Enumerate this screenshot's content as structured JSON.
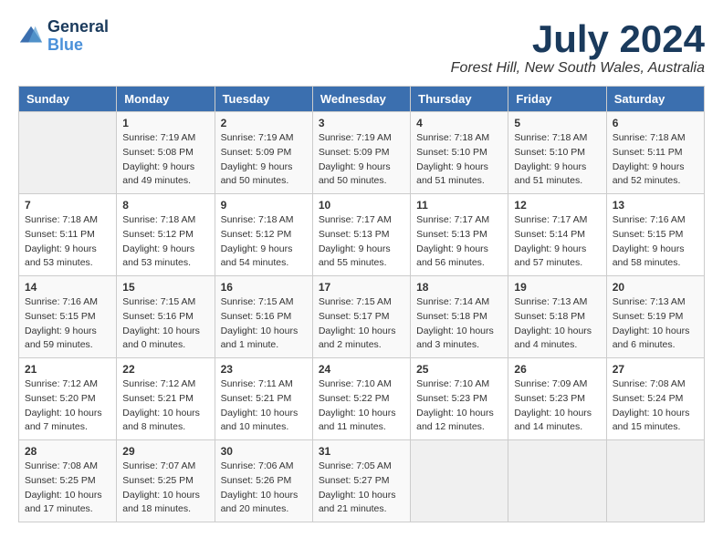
{
  "header": {
    "logo_line1": "General",
    "logo_line2": "Blue",
    "month": "July 2024",
    "location": "Forest Hill, New South Wales, Australia"
  },
  "weekdays": [
    "Sunday",
    "Monday",
    "Tuesday",
    "Wednesday",
    "Thursday",
    "Friday",
    "Saturday"
  ],
  "weeks": [
    [
      {
        "day": "",
        "info": ""
      },
      {
        "day": "1",
        "info": "Sunrise: 7:19 AM\nSunset: 5:08 PM\nDaylight: 9 hours\nand 49 minutes."
      },
      {
        "day": "2",
        "info": "Sunrise: 7:19 AM\nSunset: 5:09 PM\nDaylight: 9 hours\nand 50 minutes."
      },
      {
        "day": "3",
        "info": "Sunrise: 7:19 AM\nSunset: 5:09 PM\nDaylight: 9 hours\nand 50 minutes."
      },
      {
        "day": "4",
        "info": "Sunrise: 7:18 AM\nSunset: 5:10 PM\nDaylight: 9 hours\nand 51 minutes."
      },
      {
        "day": "5",
        "info": "Sunrise: 7:18 AM\nSunset: 5:10 PM\nDaylight: 9 hours\nand 51 minutes."
      },
      {
        "day": "6",
        "info": "Sunrise: 7:18 AM\nSunset: 5:11 PM\nDaylight: 9 hours\nand 52 minutes."
      }
    ],
    [
      {
        "day": "7",
        "info": "Sunrise: 7:18 AM\nSunset: 5:11 PM\nDaylight: 9 hours\nand 53 minutes."
      },
      {
        "day": "8",
        "info": "Sunrise: 7:18 AM\nSunset: 5:12 PM\nDaylight: 9 hours\nand 53 minutes."
      },
      {
        "day": "9",
        "info": "Sunrise: 7:18 AM\nSunset: 5:12 PM\nDaylight: 9 hours\nand 54 minutes."
      },
      {
        "day": "10",
        "info": "Sunrise: 7:17 AM\nSunset: 5:13 PM\nDaylight: 9 hours\nand 55 minutes."
      },
      {
        "day": "11",
        "info": "Sunrise: 7:17 AM\nSunset: 5:13 PM\nDaylight: 9 hours\nand 56 minutes."
      },
      {
        "day": "12",
        "info": "Sunrise: 7:17 AM\nSunset: 5:14 PM\nDaylight: 9 hours\nand 57 minutes."
      },
      {
        "day": "13",
        "info": "Sunrise: 7:16 AM\nSunset: 5:15 PM\nDaylight: 9 hours\nand 58 minutes."
      }
    ],
    [
      {
        "day": "14",
        "info": "Sunrise: 7:16 AM\nSunset: 5:15 PM\nDaylight: 9 hours\nand 59 minutes."
      },
      {
        "day": "15",
        "info": "Sunrise: 7:15 AM\nSunset: 5:16 PM\nDaylight: 10 hours\nand 0 minutes."
      },
      {
        "day": "16",
        "info": "Sunrise: 7:15 AM\nSunset: 5:16 PM\nDaylight: 10 hours\nand 1 minute."
      },
      {
        "day": "17",
        "info": "Sunrise: 7:15 AM\nSunset: 5:17 PM\nDaylight: 10 hours\nand 2 minutes."
      },
      {
        "day": "18",
        "info": "Sunrise: 7:14 AM\nSunset: 5:18 PM\nDaylight: 10 hours\nand 3 minutes."
      },
      {
        "day": "19",
        "info": "Sunrise: 7:13 AM\nSunset: 5:18 PM\nDaylight: 10 hours\nand 4 minutes."
      },
      {
        "day": "20",
        "info": "Sunrise: 7:13 AM\nSunset: 5:19 PM\nDaylight: 10 hours\nand 6 minutes."
      }
    ],
    [
      {
        "day": "21",
        "info": "Sunrise: 7:12 AM\nSunset: 5:20 PM\nDaylight: 10 hours\nand 7 minutes."
      },
      {
        "day": "22",
        "info": "Sunrise: 7:12 AM\nSunset: 5:21 PM\nDaylight: 10 hours\nand 8 minutes."
      },
      {
        "day": "23",
        "info": "Sunrise: 7:11 AM\nSunset: 5:21 PM\nDaylight: 10 hours\nand 10 minutes."
      },
      {
        "day": "24",
        "info": "Sunrise: 7:10 AM\nSunset: 5:22 PM\nDaylight: 10 hours\nand 11 minutes."
      },
      {
        "day": "25",
        "info": "Sunrise: 7:10 AM\nSunset: 5:23 PM\nDaylight: 10 hours\nand 12 minutes."
      },
      {
        "day": "26",
        "info": "Sunrise: 7:09 AM\nSunset: 5:23 PM\nDaylight: 10 hours\nand 14 minutes."
      },
      {
        "day": "27",
        "info": "Sunrise: 7:08 AM\nSunset: 5:24 PM\nDaylight: 10 hours\nand 15 minutes."
      }
    ],
    [
      {
        "day": "28",
        "info": "Sunrise: 7:08 AM\nSunset: 5:25 PM\nDaylight: 10 hours\nand 17 minutes."
      },
      {
        "day": "29",
        "info": "Sunrise: 7:07 AM\nSunset: 5:25 PM\nDaylight: 10 hours\nand 18 minutes."
      },
      {
        "day": "30",
        "info": "Sunrise: 7:06 AM\nSunset: 5:26 PM\nDaylight: 10 hours\nand 20 minutes."
      },
      {
        "day": "31",
        "info": "Sunrise: 7:05 AM\nSunset: 5:27 PM\nDaylight: 10 hours\nand 21 minutes."
      },
      {
        "day": "",
        "info": ""
      },
      {
        "day": "",
        "info": ""
      },
      {
        "day": "",
        "info": ""
      }
    ]
  ]
}
